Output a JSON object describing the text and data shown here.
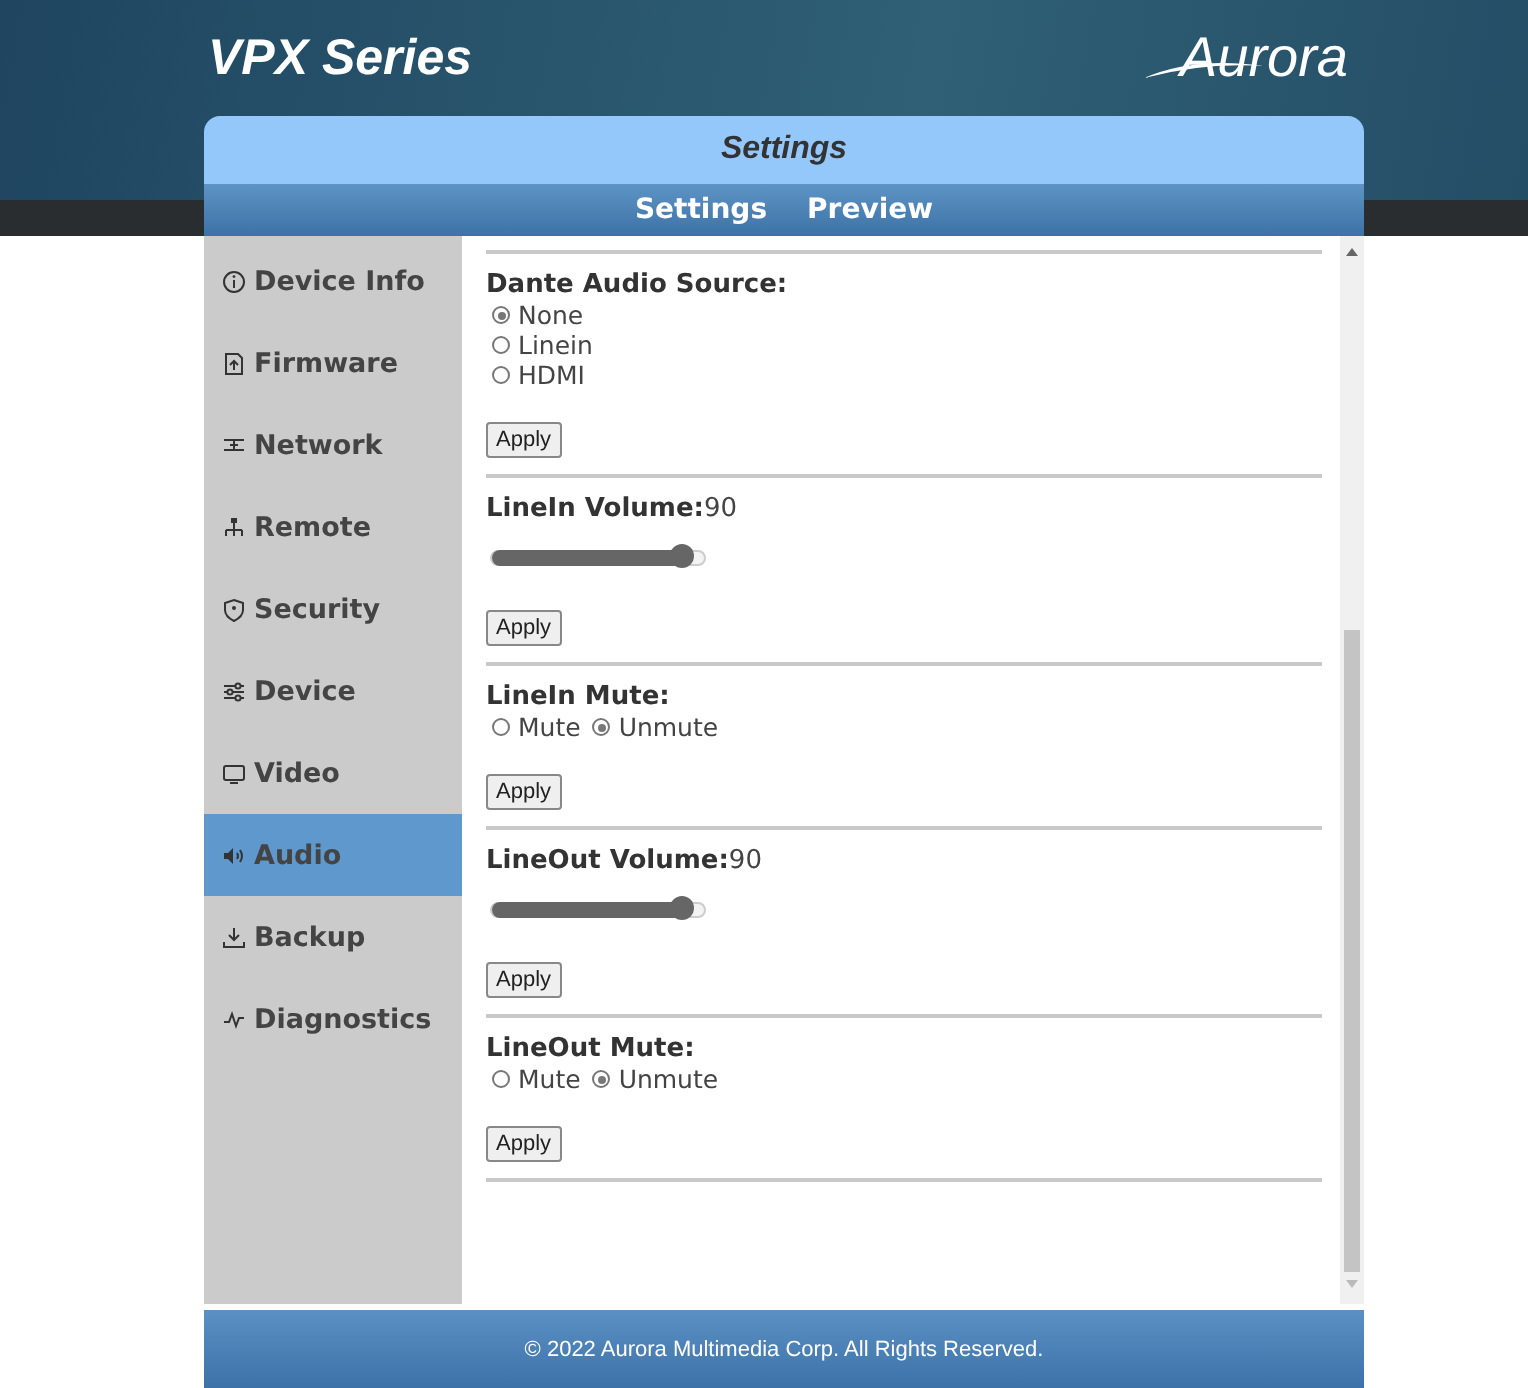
{
  "header": {
    "title": "VPX Series",
    "logo": "Aurora"
  },
  "panel": {
    "title": "Settings",
    "nav": [
      {
        "label": "Settings"
      },
      {
        "label": "Preview"
      }
    ]
  },
  "sidebar": {
    "items": [
      {
        "label": "Device Info",
        "selected": false
      },
      {
        "label": "Firmware",
        "selected": false
      },
      {
        "label": "Network",
        "selected": false
      },
      {
        "label": "Remote",
        "selected": false
      },
      {
        "label": "Security",
        "selected": false
      },
      {
        "label": "Device",
        "selected": false
      },
      {
        "label": "Video",
        "selected": false
      },
      {
        "label": "Audio",
        "selected": true
      },
      {
        "label": "Backup",
        "selected": false
      },
      {
        "label": "Diagnostics",
        "selected": false
      }
    ]
  },
  "sections": [
    {
      "kind": "radio-list",
      "title": "Dante Audio Source:",
      "options": [
        {
          "label": "None",
          "selected": true
        },
        {
          "label": "Linein",
          "selected": false
        },
        {
          "label": "HDMI",
          "selected": false
        }
      ],
      "button": "Apply"
    },
    {
      "kind": "slider",
      "title": "LineIn Volume:",
      "value": "90",
      "level": 0.9,
      "button": "Apply"
    },
    {
      "kind": "radio-inline",
      "title": "LineIn Mute:",
      "options": [
        {
          "label": "Mute",
          "selected": false
        },
        {
          "label": "Unmute",
          "selected": true
        }
      ],
      "button": "Apply"
    },
    {
      "kind": "slider",
      "title": "LineOut Volume:",
      "value": "90",
      "level": 0.9,
      "button": "Apply"
    },
    {
      "kind": "radio-inline",
      "title": "LineOut Mute:",
      "options": [
        {
          "label": "Mute",
          "selected": false
        },
        {
          "label": "Unmute",
          "selected": true
        }
      ],
      "button": "Apply"
    }
  ],
  "footer": "© 2022 Aurora Multimedia Corp. All Rights Reserved."
}
